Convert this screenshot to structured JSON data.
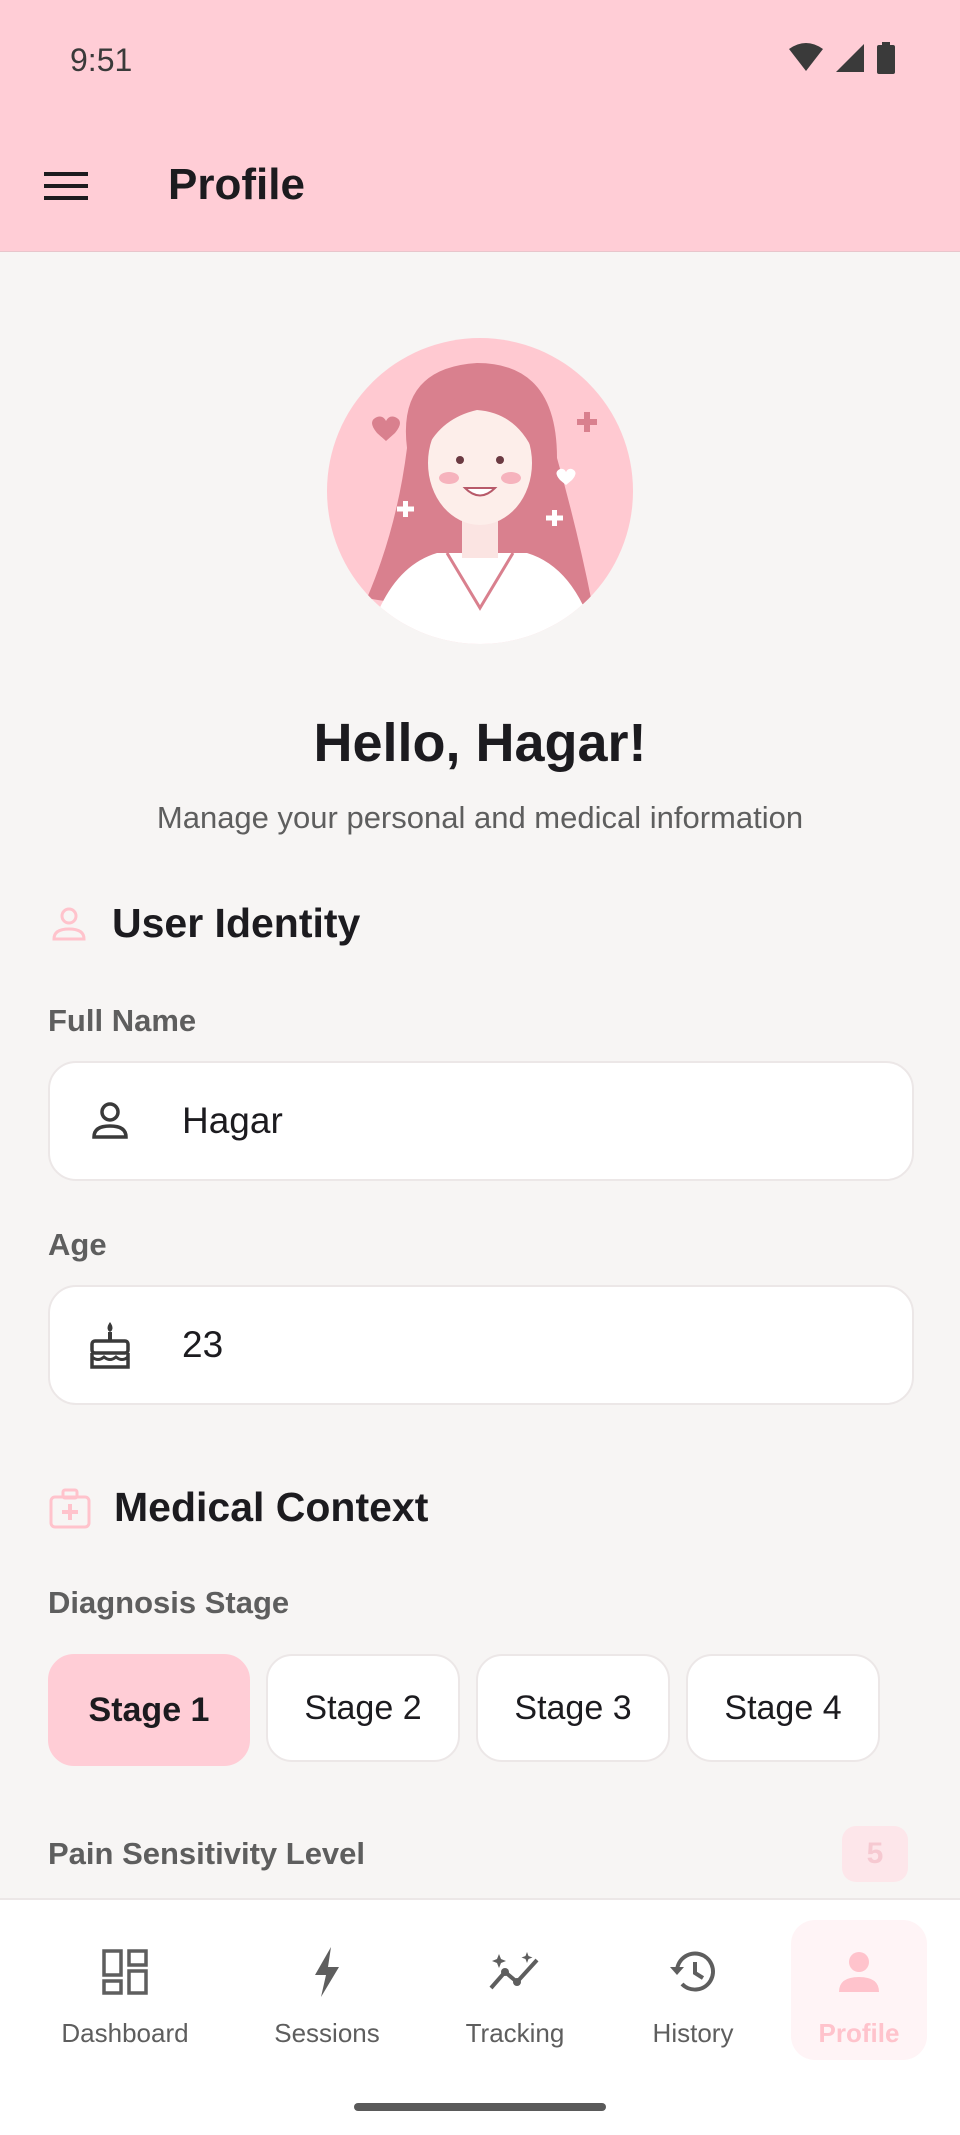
{
  "status_bar": {
    "time": "9:51",
    "icons": [
      "wifi-icon",
      "signal-icon",
      "battery-icon"
    ]
  },
  "app_bar": {
    "title": "Profile",
    "menu_icon": "menu-icon"
  },
  "greeting": {
    "title": "Hello, Hagar!",
    "subtitle": "Manage your personal and medical information"
  },
  "identity": {
    "section_title": "User Identity",
    "full_name_label": "Full Name",
    "full_name_value": "Hagar",
    "age_label": "Age",
    "age_value": "23"
  },
  "medical": {
    "section_title": "Medical Context",
    "stage_label": "Diagnosis Stage",
    "stages": [
      "Stage 1",
      "Stage 2",
      "Stage 3",
      "Stage 4"
    ],
    "selected_stage": "Stage 1",
    "pain_label": "Pain Sensitivity Level",
    "pain_value": "5"
  },
  "bottom_nav": {
    "items": [
      {
        "label": "Dashboard",
        "icon": "dashboard-icon"
      },
      {
        "label": "Sessions",
        "icon": "bolt-icon"
      },
      {
        "label": "Tracking",
        "icon": "tracking-icon"
      },
      {
        "label": "History",
        "icon": "history-icon"
      },
      {
        "label": "Profile",
        "icon": "person-icon"
      }
    ],
    "active": "Profile"
  },
  "colors": {
    "accent": "#ffcdd6",
    "accent_light": "#ffc3cc",
    "background": "#f7f5f4"
  }
}
